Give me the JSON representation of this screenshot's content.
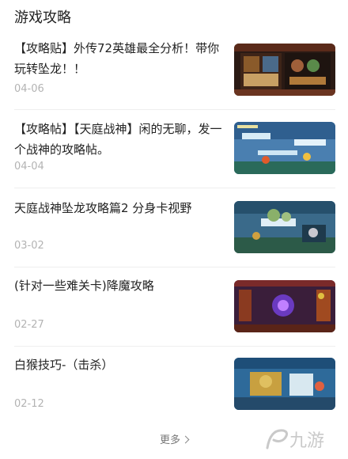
{
  "section": {
    "title": "游戏攻略"
  },
  "articles": [
    {
      "title": "【攻略贴】外传72英雄最全分析！带你玩转坠龙！！",
      "date": "04-06",
      "thumb_icon": "game-screenshot-heroes-icon"
    },
    {
      "title": "【攻略帖】【天庭战神】闲的无聊，发一个战神的攻略帖。",
      "date": "04-04",
      "thumb_icon": "game-screenshot-ice-level-icon"
    },
    {
      "title": "天庭战神坠龙攻略篇2 分身卡视野",
      "date": "03-02",
      "thumb_icon": "game-screenshot-battle-icon"
    },
    {
      "title": "(针对一些难关卡)降魔攻略",
      "date": "02-27",
      "thumb_icon": "game-screenshot-boss-icon"
    },
    {
      "title": "白猴技巧-（击杀）",
      "date": "02-12",
      "thumb_icon": "game-screenshot-monkey-icon"
    }
  ],
  "more": {
    "label": "更多"
  },
  "watermark": {
    "text": "九游"
  }
}
